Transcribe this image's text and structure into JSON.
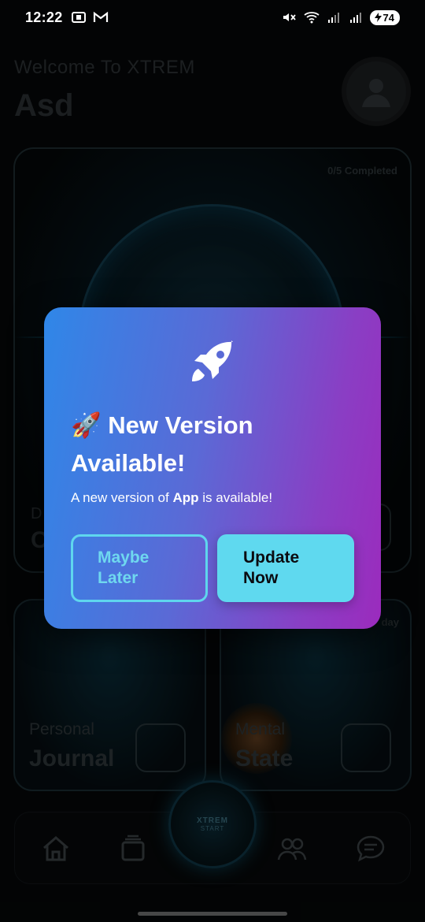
{
  "status_bar": {
    "time": "12:22",
    "battery_level": "74",
    "left_icons": [
      "screenshot-icon",
      "gmail-icon"
    ],
    "right_icons": [
      "mute-icon",
      "wifi-icon",
      "signal-icon",
      "signal-icon",
      "battery-icon"
    ]
  },
  "home": {
    "welcome": "Welcome To XTREM",
    "user_name": "Asd",
    "main_card": {
      "progress": "0/5 Completed",
      "subtitle": "D",
      "title": "C"
    },
    "tiles": [
      {
        "small": "Personal",
        "big": "Journal",
        "corner": ""
      },
      {
        "small": "Mental",
        "big": "State",
        "corner": "day"
      }
    ],
    "bottom_nav": {
      "items": [
        "home-icon",
        "cards-icon",
        "community-icon",
        "chat-icon"
      ],
      "center_top": "XTREM",
      "center_bottom": "START"
    }
  },
  "dialog": {
    "title": "🚀 New Version Available!",
    "message_prefix": "A new version of ",
    "message_app": "App",
    "message_suffix": " is available!",
    "later_button": "Maybe\nLater",
    "update_button": "Update\nNow",
    "icon": "rocket-icon"
  },
  "colors": {
    "dialog_gradient_start": "#2f87e8",
    "dialog_gradient_end": "#9b2bbd",
    "accent_cyan": "#5fd9ef"
  }
}
